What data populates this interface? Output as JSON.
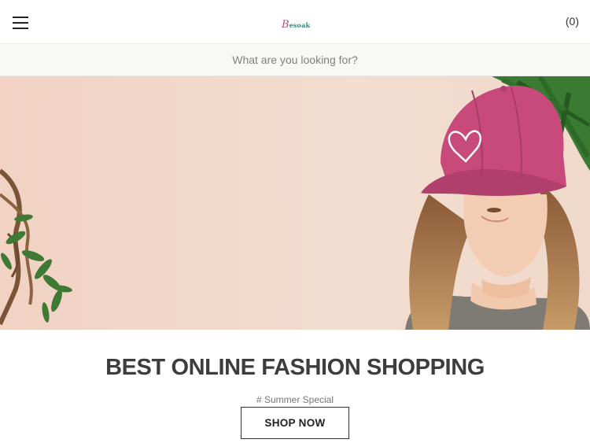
{
  "header": {
    "logo_first": "B",
    "logo_rest": "esoak",
    "cart_count": "(0)"
  },
  "search": {
    "placeholder": "What are you looking for?"
  },
  "hero": {
    "headline": "BEST ONLINE FASHION SHOPPING",
    "subline": "# Summer Special",
    "cta_label": "SHOP NOW"
  },
  "colors": {
    "hero_background": "#f0d8c8",
    "cap": "#c84a7a",
    "logo_accent": "#b5487a",
    "logo_secondary": "#2f8a7e",
    "text_dark": "#3d3d3d"
  }
}
